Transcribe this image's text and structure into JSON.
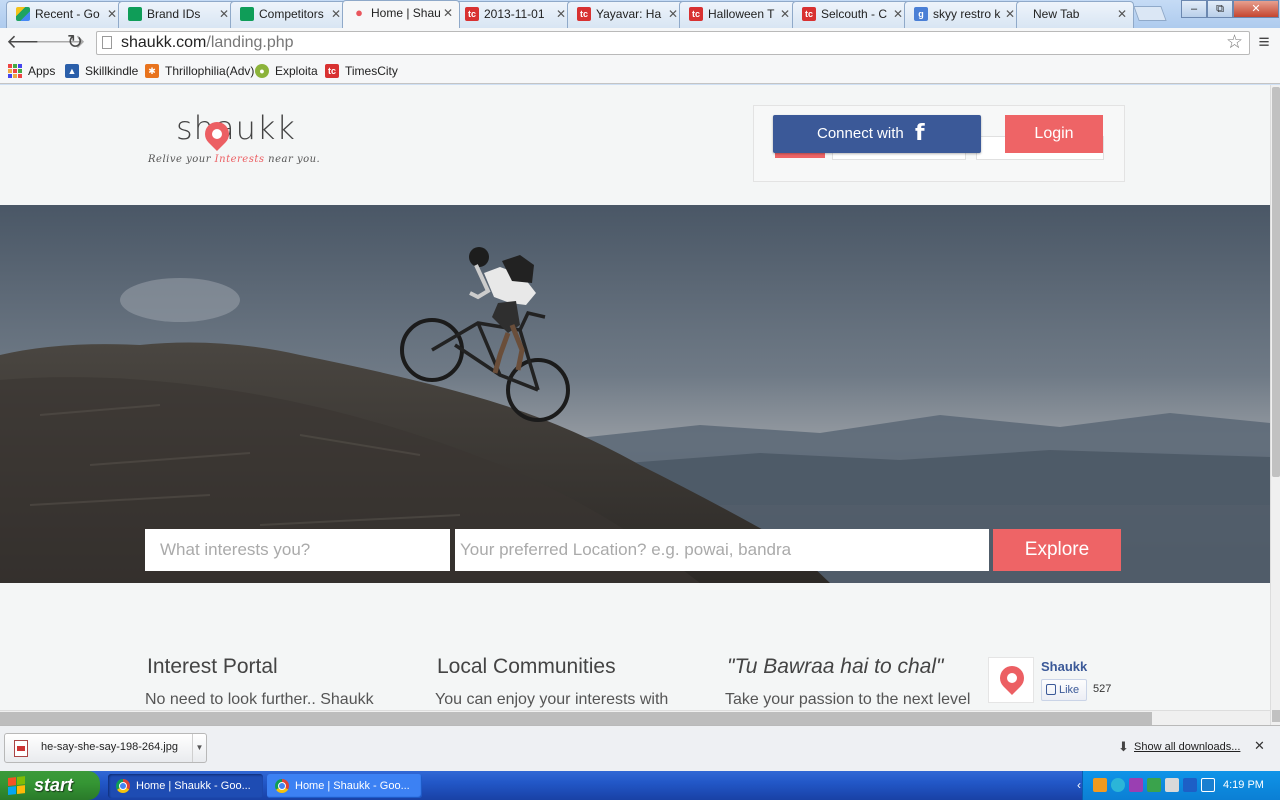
{
  "browser": {
    "tabs": [
      {
        "label": "Recent - Go",
        "icon": "google-drive-icon"
      },
      {
        "label": "Brand IDs",
        "icon": "google-sheets-icon"
      },
      {
        "label": "Competitors",
        "icon": "google-sheets-icon"
      },
      {
        "label": "Home | Shau",
        "icon": "shaukk-icon",
        "active": true
      },
      {
        "label": "2013-11-01",
        "icon": "timescity-icon"
      },
      {
        "label": "Yayavar: Ha",
        "icon": "timescity-icon"
      },
      {
        "label": "Halloween T",
        "icon": "timescity-icon"
      },
      {
        "label": "Selcouth - C",
        "icon": "timescity-icon"
      },
      {
        "label": "skyy restro k",
        "icon": "google-icon"
      },
      {
        "label": "New Tab",
        "icon": "none"
      }
    ],
    "window_controls": {
      "minimize": "–",
      "restore": "⧉",
      "close": "✕"
    },
    "url_domain": "shaukk.com",
    "url_path": "/landing.php",
    "bookmarks": [
      {
        "label": "Apps",
        "icon": "apps-grid-icon"
      },
      {
        "label": "Skillkindle",
        "icon": "skillkindle-icon"
      },
      {
        "label": "Thrillophilia(Adv)",
        "icon": "thrillophilia-icon"
      },
      {
        "label": "Exploita",
        "icon": "exploita-icon"
      },
      {
        "label": "TimesCity",
        "icon": "timescity-icon"
      }
    ]
  },
  "site": {
    "logo": "shaukk",
    "tagline_before": "Relive your ",
    "tagline_highlight": "Interests",
    "tagline_after": " near you.",
    "connect_label": "Connect with",
    "connect_icon": "f",
    "login_label": "Login",
    "search": {
      "interest_placeholder": "What interests you?",
      "location_placeholder": "Your preferred Location? e.g. powai, bandra",
      "explore_label": "Explore"
    },
    "features": [
      {
        "title": "Interest Portal",
        "text": "No need to look further.. Shaukk"
      },
      {
        "title": "Local Communities",
        "text": "You can enjoy your interests with"
      },
      {
        "title": "\"Tu Bawraa hai to chal\"",
        "text": "Take your passion to the next level"
      }
    ],
    "fb_widget": {
      "name": "Shaukk",
      "like_label": "Like",
      "like_count": "527"
    }
  },
  "download_shelf": {
    "file_name": "he-say-she-say-198-264.jpg",
    "show_all_label": "Show all downloads...",
    "close_label": "✕"
  },
  "taskbar": {
    "start_label": "start",
    "items": [
      {
        "label": "Home | Shaukk - Goo...",
        "active": true
      },
      {
        "label": "Home | Shaukk - Goo...",
        "active": false
      }
    ],
    "clock": "4:19 PM"
  },
  "colors": {
    "brand_red": "#ee6466",
    "facebook_blue": "#3b5998",
    "xp_blue": "#2257c7",
    "xp_green": "#359634"
  }
}
